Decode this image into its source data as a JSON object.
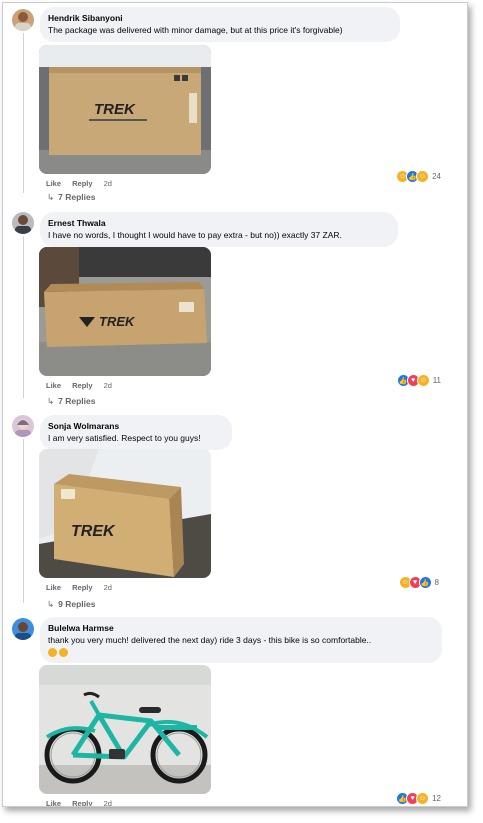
{
  "comments": [
    {
      "author": "Hendrik Sibanyoni",
      "text": "The package was delivered with minor damage, but at this price it's forgivable)",
      "like": "Like",
      "reply": "Reply",
      "time": "2d",
      "replies": "7 Replies",
      "reaction_count": "24",
      "photo_text": "TREK"
    },
    {
      "author": "Ernest Thwala",
      "text": "I have no words, I thought I would have to pay extra - but no)) exactly 37 ZAR.",
      "like": "Like",
      "reply": "Reply",
      "time": "2d",
      "replies": "7 Replies",
      "reaction_count": "11",
      "photo_text": "TREK"
    },
    {
      "author": "Sonja Wolmarans",
      "text": "I am very satisfied. Respect to you guys!",
      "like": "Like",
      "reply": "Reply",
      "time": "2d",
      "replies": "9 Replies",
      "reaction_count": "8",
      "photo_text": "TREK"
    },
    {
      "author": "Bulelwa Harmse",
      "text": "thank you very much! delivered the next day) ride 3 days - this bike is so comfortable..",
      "like": "Like",
      "reply": "Reply",
      "time": "2d",
      "reaction_count": "12"
    }
  ],
  "colors": {
    "bubble": "#f0f2f5",
    "like_blue": "#1877f2",
    "love_red": "#f33e58",
    "haha_yellow": "#f7b125",
    "bike_teal": "#1db5a3"
  }
}
